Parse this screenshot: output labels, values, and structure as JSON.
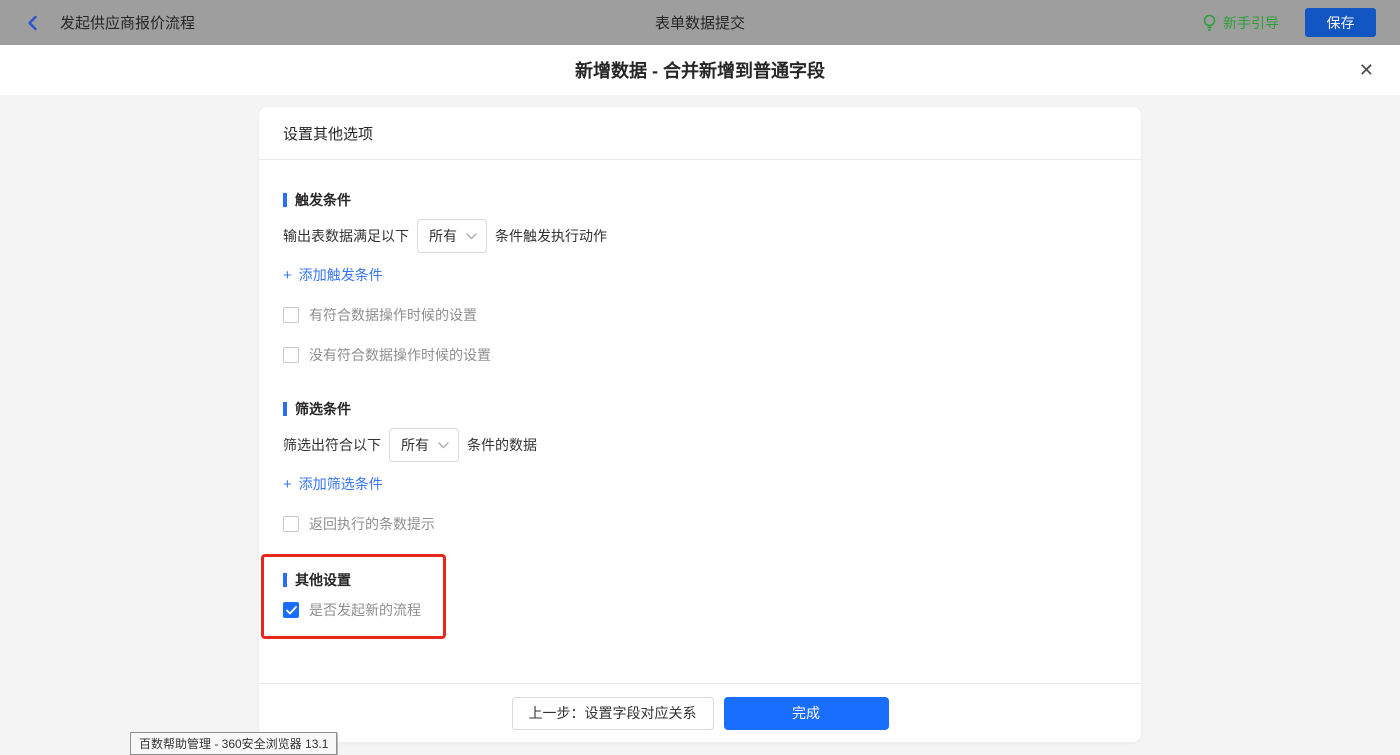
{
  "topbar": {
    "back_label": "发起供应商报价流程",
    "center_title": "表单数据提交",
    "guide_label": "新手引导",
    "save_label": "保存"
  },
  "modal": {
    "title": "新增数据 - 合并新增到普通字段",
    "close_glyph": "✕"
  },
  "card": {
    "header": "设置其他选项",
    "trigger_section": {
      "title": "触发条件",
      "row_prefix": "输出表数据满足以下",
      "dropdown_value": "所有",
      "row_suffix": "条件触发执行动作",
      "add_link": "添加触发条件",
      "checkboxes": [
        {
          "label": "有符合数据操作时候的设置",
          "checked": false
        },
        {
          "label": "没有符合数据操作时候的设置",
          "checked": false
        }
      ]
    },
    "filter_section": {
      "title": "筛选条件",
      "row_prefix": "筛选出符合以下",
      "dropdown_value": "所有",
      "row_suffix": "条件的数据",
      "add_link": "添加筛选条件",
      "checkboxes": [
        {
          "label": "返回执行的条数提示",
          "checked": false
        }
      ]
    },
    "other_section": {
      "title": "其他设置",
      "checkbox_label": "是否发起新的流程",
      "checked": true
    },
    "footer": {
      "prev_label": "上一步：设置字段对应关系",
      "done_label": "完成"
    }
  },
  "tooltip": "百数帮助管理 - 360安全浏览器 13.1",
  "icons": {
    "plus": "+"
  },
  "colors": {
    "accent_blue": "#1a6eff",
    "link_blue": "#3875f6",
    "save_blue": "#1256c4",
    "guide_green": "#2f9e39",
    "highlight_red": "#e8271c",
    "topbar_gray": "#9e9e9e"
  }
}
